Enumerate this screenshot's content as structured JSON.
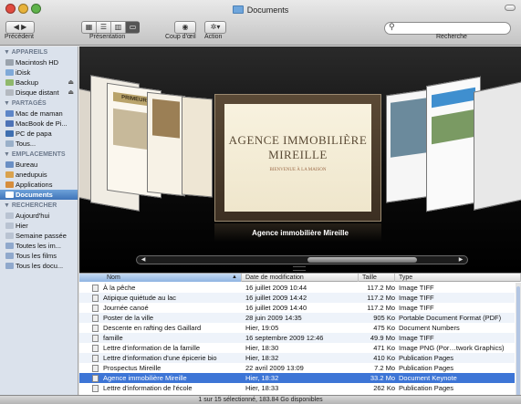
{
  "window": {
    "title": "Documents"
  },
  "toolbar": {
    "back_label": "Précédent",
    "view_label": "Présentation",
    "quicklook_label": "Coup d'œil",
    "action_label": "Action",
    "search_label": "Recherche",
    "search_placeholder": "",
    "view_active_index": 3
  },
  "sidebar": {
    "sections": [
      {
        "header": "APPAREILS",
        "items": [
          {
            "label": "Macintosh HD",
            "icon": "hard-drive-icon",
            "eject": false
          },
          {
            "label": "iDisk",
            "icon": "idisk-icon",
            "eject": false
          },
          {
            "label": "Backup",
            "icon": "external-drive-icon",
            "eject": true
          },
          {
            "label": "Disque distant",
            "icon": "remote-disk-icon",
            "eject": true
          }
        ]
      },
      {
        "header": "PARTAGÉS",
        "items": [
          {
            "label": "Mac de maman",
            "icon": "computer-icon",
            "eject": false
          },
          {
            "label": "MacBook de Pi...",
            "icon": "laptop-icon",
            "eject": false
          },
          {
            "label": "PC de papa",
            "icon": "pc-icon",
            "eject": false
          },
          {
            "label": "Tous...",
            "icon": "network-icon",
            "eject": false
          }
        ]
      },
      {
        "header": "EMPLACEMENTS",
        "items": [
          {
            "label": "Bureau",
            "icon": "desktop-icon",
            "eject": false
          },
          {
            "label": "anedupuis",
            "icon": "home-icon",
            "eject": false
          },
          {
            "label": "Applications",
            "icon": "applications-icon",
            "eject": false
          },
          {
            "label": "Documents",
            "icon": "documents-folder-icon",
            "eject": false,
            "selected": true
          }
        ]
      },
      {
        "header": "RECHERCHER",
        "items": [
          {
            "label": "Aujourd'hui",
            "icon": "clock-icon",
            "eject": false
          },
          {
            "label": "Hier",
            "icon": "clock-icon",
            "eject": false
          },
          {
            "label": "Semaine passée",
            "icon": "clock-icon",
            "eject": false
          },
          {
            "label": "Toutes les im...",
            "icon": "smart-folder-icon",
            "eject": false
          },
          {
            "label": "Tous les films",
            "icon": "smart-folder-icon",
            "eject": false
          },
          {
            "label": "Tous les docu...",
            "icon": "smart-folder-icon",
            "eject": false
          }
        ]
      }
    ]
  },
  "coverflow": {
    "center_title_1": "AGENCE IMMOBILIÈRE",
    "center_title_2": "MIREILLE",
    "center_subtitle": "BIENVENUE À LA MAISON",
    "left_cover_text": "PRIMEUR",
    "caption": "Agence immobilière Mireille",
    "scroll_position": 0.8
  },
  "list": {
    "columns": [
      "Nom",
      "Date de modification",
      "Taille",
      "Type"
    ],
    "sorted_column": 0,
    "rows": [
      {
        "name": "À la pêche",
        "date": "16 juillet 2009 10:44",
        "size": "117.2 Mo",
        "type": "Image TIFF"
      },
      {
        "name": "Atipique quiétude au lac",
        "date": "16 juillet 2009 14:42",
        "size": "117.2 Mo",
        "type": "Image TIFF"
      },
      {
        "name": "Journée canoé",
        "date": "16 juillet 2009 14:40",
        "size": "117.2 Mo",
        "type": "Image TIFF"
      },
      {
        "name": "Poster de la ville",
        "date": "28 juin 2009 14:35",
        "size": "905 Ko",
        "type": "Portable Document Format (PDF)"
      },
      {
        "name": "Descente en rafting des Gaillard",
        "date": "Hier, 19:05",
        "size": "475 Ko",
        "type": "Document Numbers"
      },
      {
        "name": "famille",
        "date": "16 septembre 2009 12:46",
        "size": "49.9 Mo",
        "type": "Image TIFF"
      },
      {
        "name": "Lettre d'information de la famille",
        "date": "Hier, 18:30",
        "size": "471 Ko",
        "type": "Image PNG (Por…twork Graphics)"
      },
      {
        "name": "Lettre d'information d'une épicerie bio",
        "date": "Hier, 18:32",
        "size": "410 Ko",
        "type": "Publication Pages"
      },
      {
        "name": "Prospectus Mireille",
        "date": "22 avril 2009 13:09",
        "size": "7.2 Mo",
        "type": "Publication Pages"
      },
      {
        "name": "Agence immobilière Mireille",
        "date": "Hier, 18:32",
        "size": "33.2 Mo",
        "type": "Document Keynote",
        "selected": true
      },
      {
        "name": "Lettre d'information de l'école",
        "date": "Hier, 18:33",
        "size": "262 Ko",
        "type": "Publication Pages"
      }
    ]
  },
  "status": {
    "text": "1 sur 15 sélectionné, 183.84 Go disponibles"
  },
  "colors": {
    "selection": "#3d75d6",
    "sidebar_bg": "#dbe2ec",
    "coverflow_bg": "#000000"
  }
}
